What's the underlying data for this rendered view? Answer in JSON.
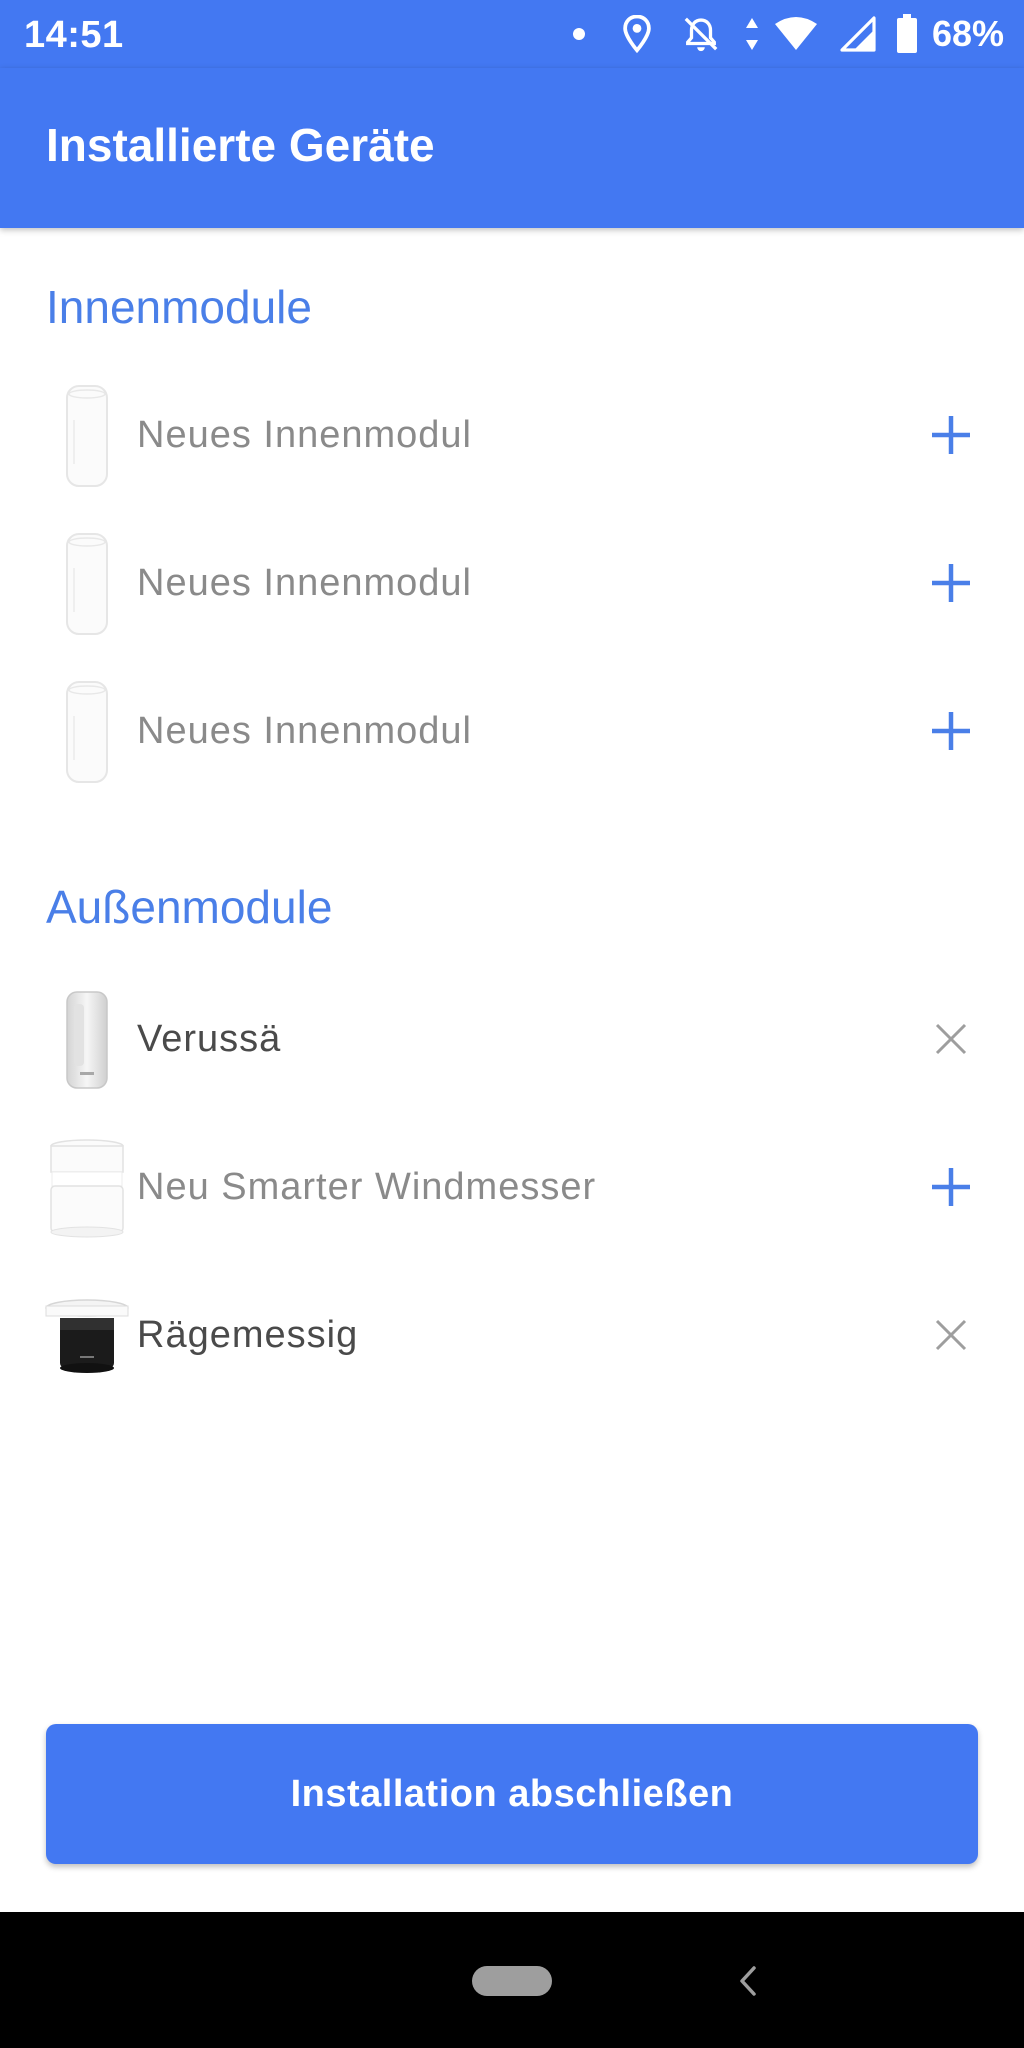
{
  "status_bar": {
    "time": "14:51",
    "battery_percent": "68%",
    "icons": [
      "notification-dot-icon",
      "location-icon",
      "notifications-off-icon",
      "data-arrows-icon",
      "wifi-icon",
      "cell-signal-icon",
      "battery-icon"
    ]
  },
  "app_bar": {
    "title": "Installierte Geräte",
    "color": "#4378F2"
  },
  "indoor": {
    "title": "Innenmodule",
    "items": [
      {
        "label": "Neues Innenmodul",
        "action": "add",
        "action_icon": "plus-icon"
      },
      {
        "label": "Neues Innenmodul",
        "action": "add",
        "action_icon": "plus-icon"
      },
      {
        "label": "Neues Innenmodul",
        "action": "add",
        "action_icon": "plus-icon"
      }
    ]
  },
  "outdoor": {
    "title": "Außenmodule",
    "items": [
      {
        "label": "Verussä",
        "action": "remove",
        "action_icon": "close-icon"
      },
      {
        "label": "Neu Smarter Windmesser",
        "action": "add",
        "action_icon": "plus-icon"
      },
      {
        "label": "Rägemessig",
        "action": "remove",
        "action_icon": "close-icon"
      }
    ]
  },
  "finish_button": {
    "label": "Installation abschließen"
  },
  "nav_bar": {
    "icons": [
      "home-pill-icon",
      "back-chevron-icon"
    ]
  },
  "colors": {
    "accent": "#4378F2",
    "section_title": "#4A7FE8",
    "inactive_text": "#8A8A8A",
    "active_text": "#4A4A4A"
  }
}
